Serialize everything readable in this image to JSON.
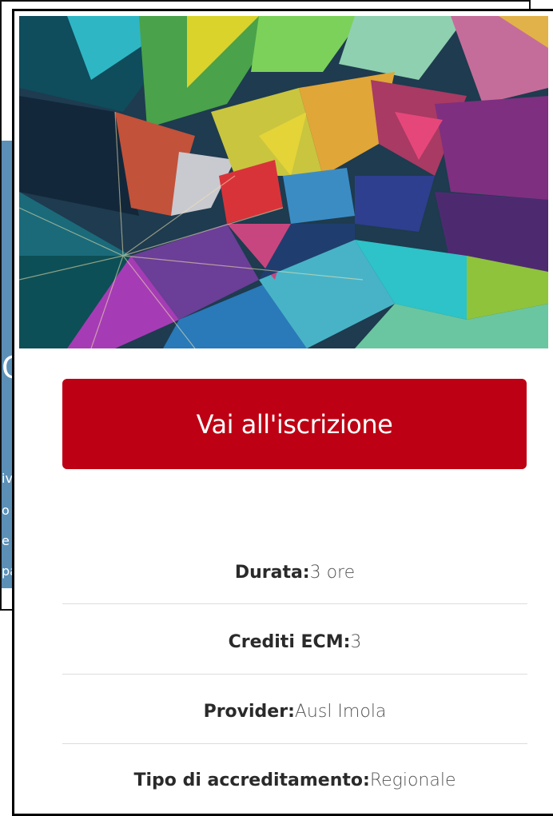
{
  "background": {
    "heading_fragment": "C",
    "text_fragments": [
      "iv",
      "o",
      "e",
      "pa"
    ]
  },
  "card": {
    "cta_label": "Vai all'iscrizione",
    "details": [
      {
        "label": "Durata:",
        "value": "3 ore"
      },
      {
        "label": "Crediti ECM:",
        "value": "3"
      },
      {
        "label": "Provider:",
        "value": "Ausl Imola"
      },
      {
        "label": "Tipo di accreditamento:",
        "value": "Regionale"
      }
    ]
  },
  "colors": {
    "cta_background": "#bd0013",
    "side_panel": "#5b8fb6"
  }
}
